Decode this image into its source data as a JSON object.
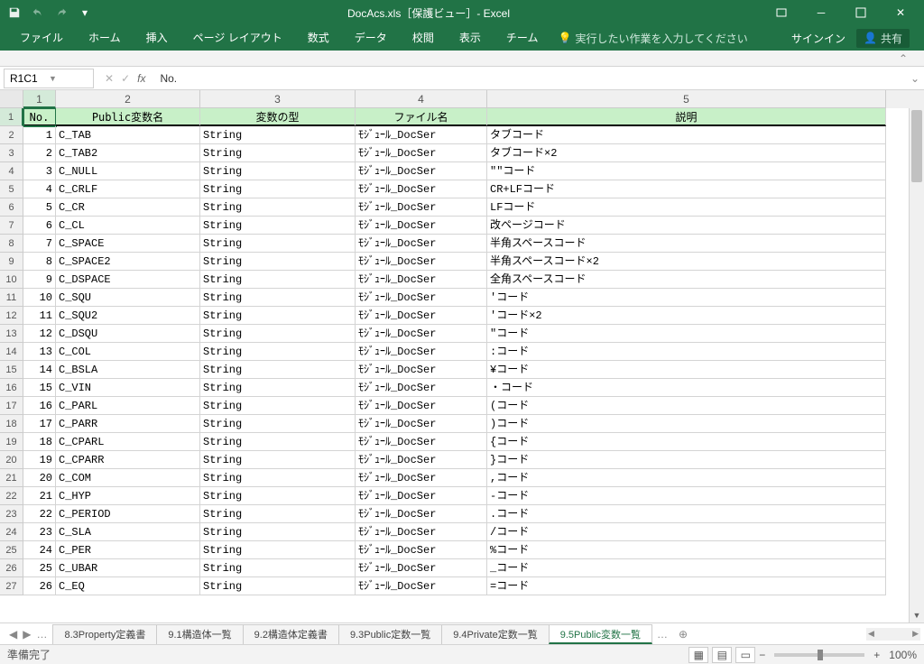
{
  "title": "DocAcs.xls［保護ビュー］- Excel",
  "ribbon": {
    "tabs": [
      "ファイル",
      "ホーム",
      "挿入",
      "ページ レイアウト",
      "数式",
      "データ",
      "校閲",
      "表示",
      "チーム"
    ],
    "tell": "実行したい作業を入力してください",
    "signin": "サインイン",
    "share": "共有"
  },
  "name_box": "R1C1",
  "formula": "No.",
  "col_headers": [
    "1",
    "2",
    "3",
    "4",
    "5"
  ],
  "headers": [
    "No.",
    "Public変数名",
    "変数の型",
    "ファイル名",
    "説明"
  ],
  "rows": [
    {
      "n": "1",
      "name": "C_TAB",
      "type": "String",
      "file": "ﾓｼﾞｭｰﾙ_DocSer",
      "desc": "タブコード"
    },
    {
      "n": "2",
      "name": "C_TAB2",
      "type": "String",
      "file": "ﾓｼﾞｭｰﾙ_DocSer",
      "desc": "タブコード×2"
    },
    {
      "n": "3",
      "name": "C_NULL",
      "type": "String",
      "file": "ﾓｼﾞｭｰﾙ_DocSer",
      "desc": "\"\"コード"
    },
    {
      "n": "4",
      "name": "C_CRLF",
      "type": "String",
      "file": "ﾓｼﾞｭｰﾙ_DocSer",
      "desc": "CR+LFコード"
    },
    {
      "n": "5",
      "name": "C_CR",
      "type": "String",
      "file": "ﾓｼﾞｭｰﾙ_DocSer",
      "desc": "LFコード"
    },
    {
      "n": "6",
      "name": "C_CL",
      "type": "String",
      "file": "ﾓｼﾞｭｰﾙ_DocSer",
      "desc": "改ページコード"
    },
    {
      "n": "7",
      "name": "C_SPACE",
      "type": "String",
      "file": "ﾓｼﾞｭｰﾙ_DocSer",
      "desc": "半角スペースコード"
    },
    {
      "n": "8",
      "name": "C_SPACE2",
      "type": "String",
      "file": "ﾓｼﾞｭｰﾙ_DocSer",
      "desc": "半角スペースコード×2"
    },
    {
      "n": "9",
      "name": "C_DSPACE",
      "type": "String",
      "file": "ﾓｼﾞｭｰﾙ_DocSer",
      "desc": "全角スペースコード"
    },
    {
      "n": "10",
      "name": "C_SQU",
      "type": "String",
      "file": "ﾓｼﾞｭｰﾙ_DocSer",
      "desc": "'コード"
    },
    {
      "n": "11",
      "name": "C_SQU2",
      "type": "String",
      "file": "ﾓｼﾞｭｰﾙ_DocSer",
      "desc": "'コード×2"
    },
    {
      "n": "12",
      "name": "C_DSQU",
      "type": "String",
      "file": "ﾓｼﾞｭｰﾙ_DocSer",
      "desc": "\"コード"
    },
    {
      "n": "13",
      "name": "C_COL",
      "type": "String",
      "file": "ﾓｼﾞｭｰﾙ_DocSer",
      "desc": ":コード"
    },
    {
      "n": "14",
      "name": "C_BSLA",
      "type": "String",
      "file": "ﾓｼﾞｭｰﾙ_DocSer",
      "desc": "¥コード"
    },
    {
      "n": "15",
      "name": "C_VIN",
      "type": "String",
      "file": "ﾓｼﾞｭｰﾙ_DocSer",
      "desc": "・コード"
    },
    {
      "n": "16",
      "name": "C_PARL",
      "type": "String",
      "file": "ﾓｼﾞｭｰﾙ_DocSer",
      "desc": "(コード"
    },
    {
      "n": "17",
      "name": "C_PARR",
      "type": "String",
      "file": "ﾓｼﾞｭｰﾙ_DocSer",
      "desc": ")コード"
    },
    {
      "n": "18",
      "name": "C_CPARL",
      "type": "String",
      "file": "ﾓｼﾞｭｰﾙ_DocSer",
      "desc": "{コード"
    },
    {
      "n": "19",
      "name": "C_CPARR",
      "type": "String",
      "file": "ﾓｼﾞｭｰﾙ_DocSer",
      "desc": "}コード"
    },
    {
      "n": "20",
      "name": "C_COM",
      "type": "String",
      "file": "ﾓｼﾞｭｰﾙ_DocSer",
      "desc": ",コード"
    },
    {
      "n": "21",
      "name": "C_HYP",
      "type": "String",
      "file": "ﾓｼﾞｭｰﾙ_DocSer",
      "desc": " -コード"
    },
    {
      "n": "22",
      "name": "C_PERIOD",
      "type": "String",
      "file": "ﾓｼﾞｭｰﾙ_DocSer",
      "desc": ".コード"
    },
    {
      "n": "23",
      "name": "C_SLA",
      "type": "String",
      "file": "ﾓｼﾞｭｰﾙ_DocSer",
      "desc": "/コード"
    },
    {
      "n": "24",
      "name": "C_PER",
      "type": "String",
      "file": "ﾓｼﾞｭｰﾙ_DocSer",
      "desc": "%コード"
    },
    {
      "n": "25",
      "name": "C_UBAR",
      "type": "String",
      "file": "ﾓｼﾞｭｰﾙ_DocSer",
      "desc": "_コード"
    },
    {
      "n": "26",
      "name": "C_EQ",
      "type": "String",
      "file": "ﾓｼﾞｭｰﾙ_DocSer",
      "desc": " =コード"
    }
  ],
  "sheets": {
    "list": [
      "8.3Property定義書",
      "9.1構造体一覧",
      "9.2構造体定義書",
      "9.3Public定数一覧",
      "9.4Private定数一覧",
      "9.5Public変数一覧"
    ],
    "active": 5
  },
  "status": {
    "ready": "準備完了",
    "zoom": "100%"
  }
}
